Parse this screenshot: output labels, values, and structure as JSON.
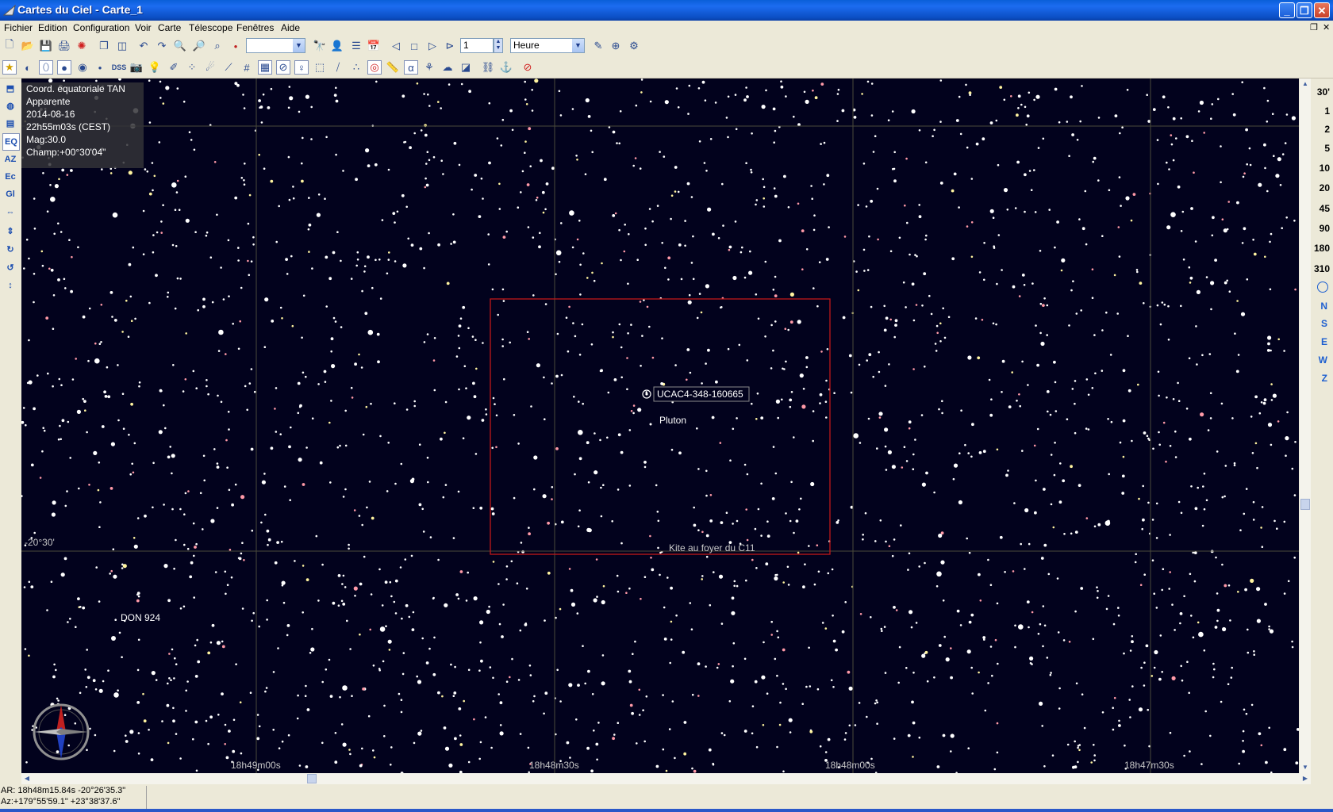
{
  "window": {
    "title": "Cartes du Ciel - Carte_1",
    "minimize": "_",
    "restore": "❐",
    "close": "✕"
  },
  "menu": {
    "items": [
      "Fichier",
      "Edition",
      "Configuration",
      "Voir",
      "Carte",
      "Télescope",
      "Fenêtres",
      "Aide"
    ],
    "mdi_restore": "❐",
    "mdi_close": "✕"
  },
  "toolbar": {
    "animation_step": "1",
    "time_unit": "Heure",
    "dss_label": "DSS"
  },
  "info": {
    "lines": [
      "Coord. equatoriale TAN",
      "Apparente",
      "2014-08-16",
      "22h55m03s (CEST)",
      "Mag:30.0",
      "Champ:+00°30'04\""
    ]
  },
  "chart": {
    "ra_labels": [
      "18h49m00s",
      "18h48m30s",
      "18h48m00s",
      "18h47m30s"
    ],
    "dec_label": "-20°30'",
    "target_label": "UCAC4-348-160665",
    "planet_label": "Pluton",
    "double_star_label": "DON 924",
    "fov_label": "Kite au foyer du C11",
    "colors": {
      "background": "#02021d",
      "grid": "#4a4a3a",
      "fov": "#c01818",
      "star": "#ffffff",
      "star_red": "#ff9aa8",
      "star_yellow": "#fff4a0"
    }
  },
  "scale": {
    "fields": [
      "30'",
      "1",
      "2",
      "5",
      "10",
      "20",
      "45",
      "90",
      "180",
      "310"
    ],
    "directions": [
      "N",
      "S",
      "E",
      "W",
      "Z"
    ]
  },
  "status": {
    "line1": "AR: 18h48m15.84s -20°26'35.3\"",
    "line2": "Az:+179°55'59.1\" +23°38'37.6\""
  }
}
